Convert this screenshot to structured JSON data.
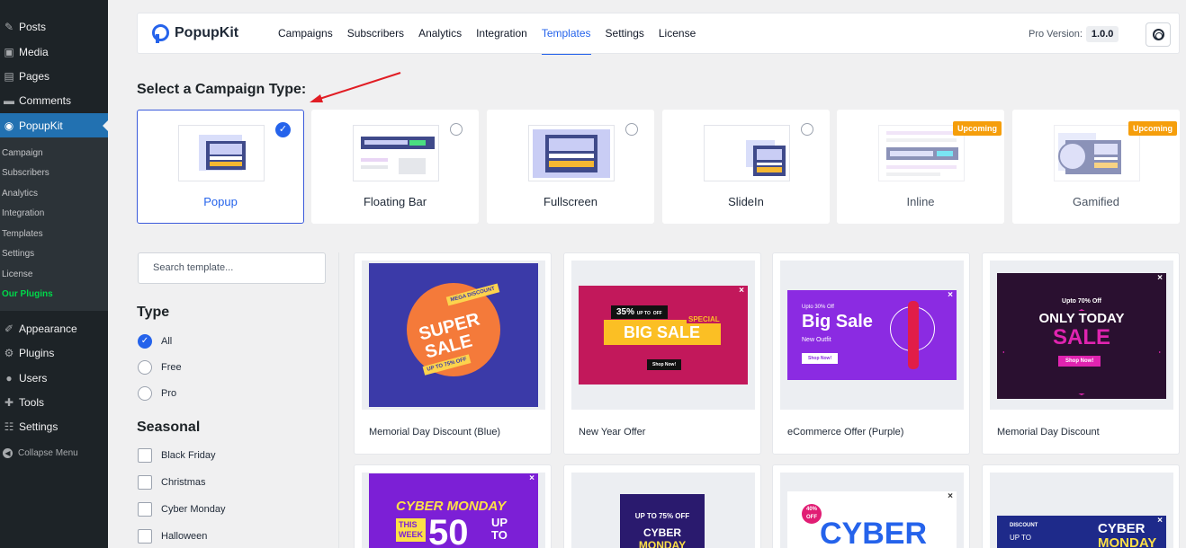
{
  "wp_menu": {
    "items": [
      {
        "label": "Posts",
        "icon": "pin-icon"
      },
      {
        "label": "Media",
        "icon": "media-icon"
      },
      {
        "label": "Pages",
        "icon": "pages-icon"
      },
      {
        "label": "Comments",
        "icon": "comments-icon"
      },
      {
        "label": "PopupKit",
        "icon": "popupkit-icon",
        "active": true
      }
    ],
    "submenu": [
      "Campaign",
      "Subscribers",
      "Analytics",
      "Integration",
      "Templates",
      "Settings",
      "License",
      "Our Plugins"
    ],
    "lower": [
      {
        "label": "Appearance",
        "icon": "appearance-icon"
      },
      {
        "label": "Plugins",
        "icon": "plugins-icon"
      },
      {
        "label": "Users",
        "icon": "users-icon"
      },
      {
        "label": "Tools",
        "icon": "tools-icon"
      },
      {
        "label": "Settings",
        "icon": "settings-icon"
      }
    ],
    "collapse": "Collapse Menu"
  },
  "header": {
    "logo": "PopupKit",
    "tabs": [
      "Campaigns",
      "Subscribers",
      "Analytics",
      "Integration",
      "Templates",
      "Settings",
      "License"
    ],
    "active_tab": "Templates",
    "pro_label": "Pro Version:",
    "pro_version": "1.0.0"
  },
  "campaign": {
    "heading": "Select a Campaign Type:",
    "types": [
      {
        "label": "Popup",
        "selected": true
      },
      {
        "label": "Floating Bar"
      },
      {
        "label": "Fullscreen"
      },
      {
        "label": "SlideIn"
      },
      {
        "label": "Inline",
        "badge": "Upcoming"
      },
      {
        "label": "Gamified",
        "badge": "Upcoming"
      }
    ]
  },
  "filters": {
    "search_placeholder": "Search template...",
    "type_heading": "Type",
    "types": [
      "All",
      "Free",
      "Pro"
    ],
    "seasonal_heading": "Seasonal",
    "seasonal": [
      "Black Friday",
      "Christmas",
      "Cyber Monday",
      "Halloween"
    ]
  },
  "templates": [
    {
      "name": "Memorial Day Discount (Blue)",
      "tag": "MEGA DISCOUNT",
      "l1": "SUPER",
      "l2": "SALE",
      "sub": "UP TO 75% OFF"
    },
    {
      "name": "New Year Offer",
      "pct": "35%",
      "upto": "UP TO",
      "off": "OFF",
      "special": "SPECIAL",
      "big": "BIG SALE",
      "btn": "Shop Now!"
    },
    {
      "name": "eCommerce Offer (Purple)",
      "small": "Upto 30% Off",
      "big": "Big Sale",
      "sub": "New Outfit",
      "btn": "Shop Now!"
    },
    {
      "name": "Memorial Day Discount",
      "small": "Upto 70% Off",
      "l1": "ONLY TODAY",
      "l2": "SALE",
      "btn": "Shop Now!"
    }
  ],
  "templates_row2": [
    {
      "l1": "CYBER MONDAY",
      "this": "THIS",
      "week": "WEEK",
      "num": "50",
      "up": "UP",
      "to": "TO"
    },
    {
      "pct": "UP TO 75% OFF",
      "l1": "CYBER",
      "l2": "MONDAY"
    },
    {
      "badge": "40% OFF",
      "l1": "CYBER"
    },
    {
      "small": "DISCOUNT",
      "upto": "UP TO",
      "l1": "CYBER",
      "l2": "MONDAY"
    }
  ],
  "colors": {
    "accent": "#2563eb",
    "wp_sidebar": "#1d2327",
    "wp_active": "#2271b1",
    "badge": "#f59e0b",
    "arrow": "#e11d24"
  }
}
